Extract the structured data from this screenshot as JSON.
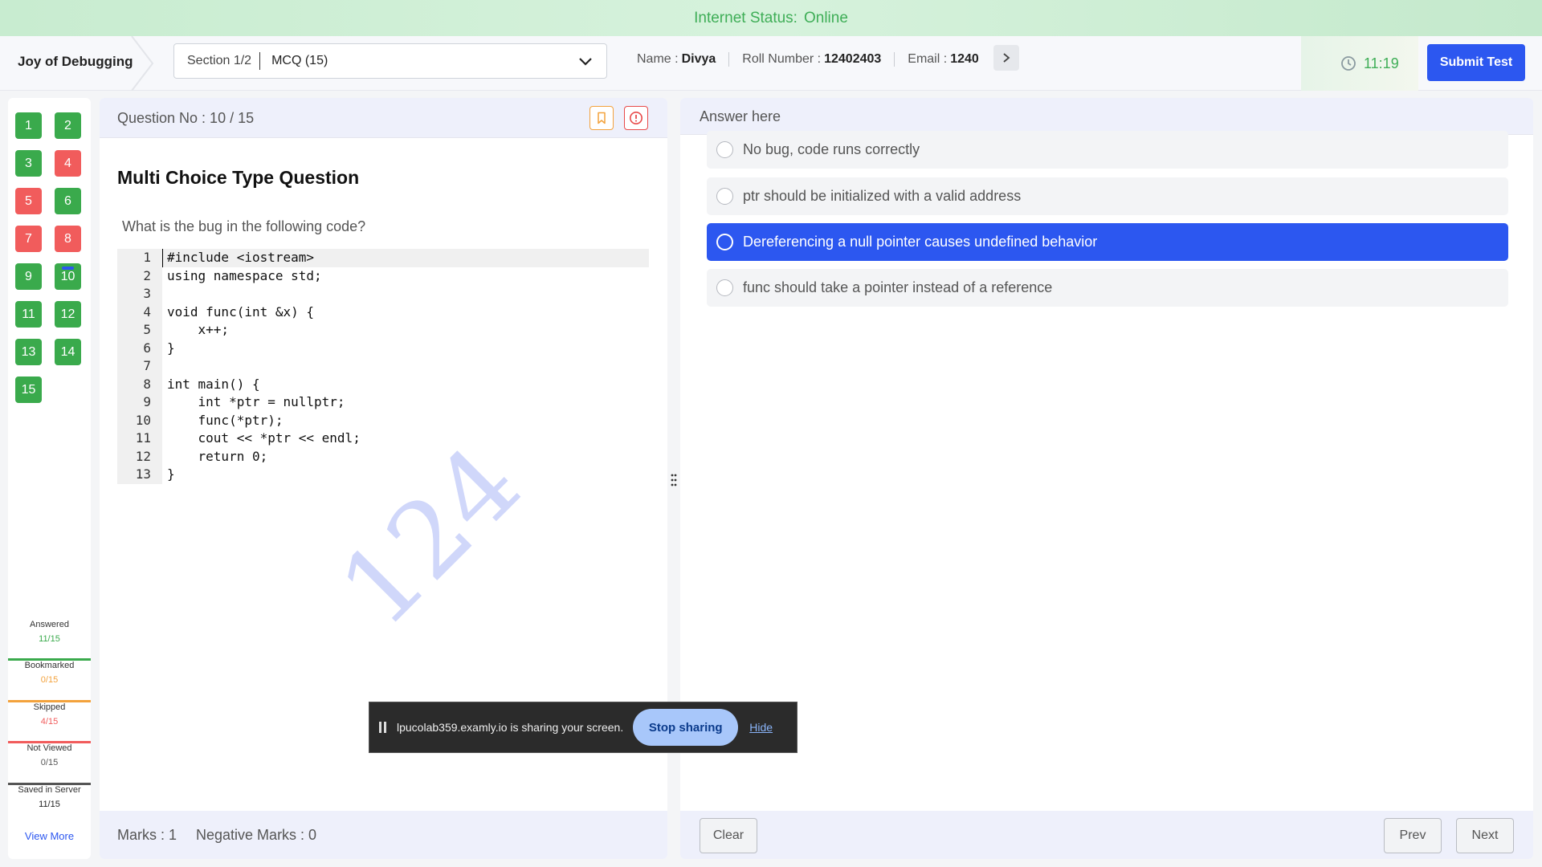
{
  "status": {
    "label": "Internet Status:",
    "value": "Online"
  },
  "header": {
    "app_title": "Joy of Debugging",
    "section": {
      "label": "Section 1/2",
      "mcq": "MCQ (15)"
    },
    "name_label": "Name :",
    "name": "Divya",
    "roll_label": "Roll Number :",
    "roll": "12402403",
    "email_label": "Email :",
    "email": "1240",
    "timer": "11:19",
    "submit_label": "Submit Test"
  },
  "palette": {
    "questions": [
      {
        "n": "1",
        "state": "green"
      },
      {
        "n": "2",
        "state": "green"
      },
      {
        "n": "3",
        "state": "green"
      },
      {
        "n": "4",
        "state": "red"
      },
      {
        "n": "5",
        "state": "red"
      },
      {
        "n": "6",
        "state": "green"
      },
      {
        "n": "7",
        "state": "red"
      },
      {
        "n": "8",
        "state": "red"
      },
      {
        "n": "9",
        "state": "green"
      },
      {
        "n": "10",
        "state": "green"
      },
      {
        "n": "11",
        "state": "green"
      },
      {
        "n": "12",
        "state": "green"
      },
      {
        "n": "13",
        "state": "green"
      },
      {
        "n": "14",
        "state": "green"
      },
      {
        "n": "15",
        "state": "green"
      }
    ],
    "legend": {
      "answered_label": "Answered",
      "answered": "11/15",
      "bookmarked_label": "Bookmarked",
      "bookmarked": "0/15",
      "skipped_label": "Skipped",
      "skipped": "4/15",
      "not_viewed_label": "Not Viewed",
      "not_viewed": "0/15",
      "saved_label": "Saved in Server",
      "saved": "11/15"
    },
    "view_more": "View More",
    "colors": {
      "answered": "#3aaa4c",
      "bookmarked": "#f3a23c",
      "skipped": "#f15c5c",
      "not_viewed": "#555555",
      "current": "#2c57f0"
    }
  },
  "question": {
    "number_label": "Question No : 10 / 15",
    "type": "Multi Choice Type Question",
    "text": "What is the bug in the following code?",
    "code": [
      {
        "n": "1",
        "src": "#include <iostream>"
      },
      {
        "n": "2",
        "src": "using namespace std;"
      },
      {
        "n": "3",
        "src": ""
      },
      {
        "n": "4",
        "src": "void func(int &x) {"
      },
      {
        "n": "5",
        "src": "    x++;"
      },
      {
        "n": "6",
        "src": "}"
      },
      {
        "n": "7",
        "src": ""
      },
      {
        "n": "8",
        "src": "int main() {"
      },
      {
        "n": "9",
        "src": "    int *ptr = nullptr;"
      },
      {
        "n": "10",
        "src": "    func(*ptr);"
      },
      {
        "n": "11",
        "src": "    cout << *ptr << endl;"
      },
      {
        "n": "12",
        "src": "    return 0;"
      },
      {
        "n": "13",
        "src": "}"
      }
    ],
    "watermark": "124",
    "marks_label": "Marks : 1",
    "negative_label": "Negative Marks : 0"
  },
  "answer": {
    "header": "Answer here",
    "options": [
      {
        "label": "No bug, code runs correctly",
        "selected": false
      },
      {
        "label": "ptr should be initialized with a valid address",
        "selected": false
      },
      {
        "label": "Dereferencing a null pointer causes undefined behavior",
        "selected": true
      },
      {
        "label": "func should take a pointer instead of a reference",
        "selected": false
      }
    ],
    "clear_label": "Clear",
    "prev_label": "Prev",
    "next_label": "Next"
  },
  "share_bar": {
    "message": "lpucolab359.examly.io is sharing your screen.",
    "stop_label": "Stop sharing",
    "hide_label": "Hide"
  }
}
